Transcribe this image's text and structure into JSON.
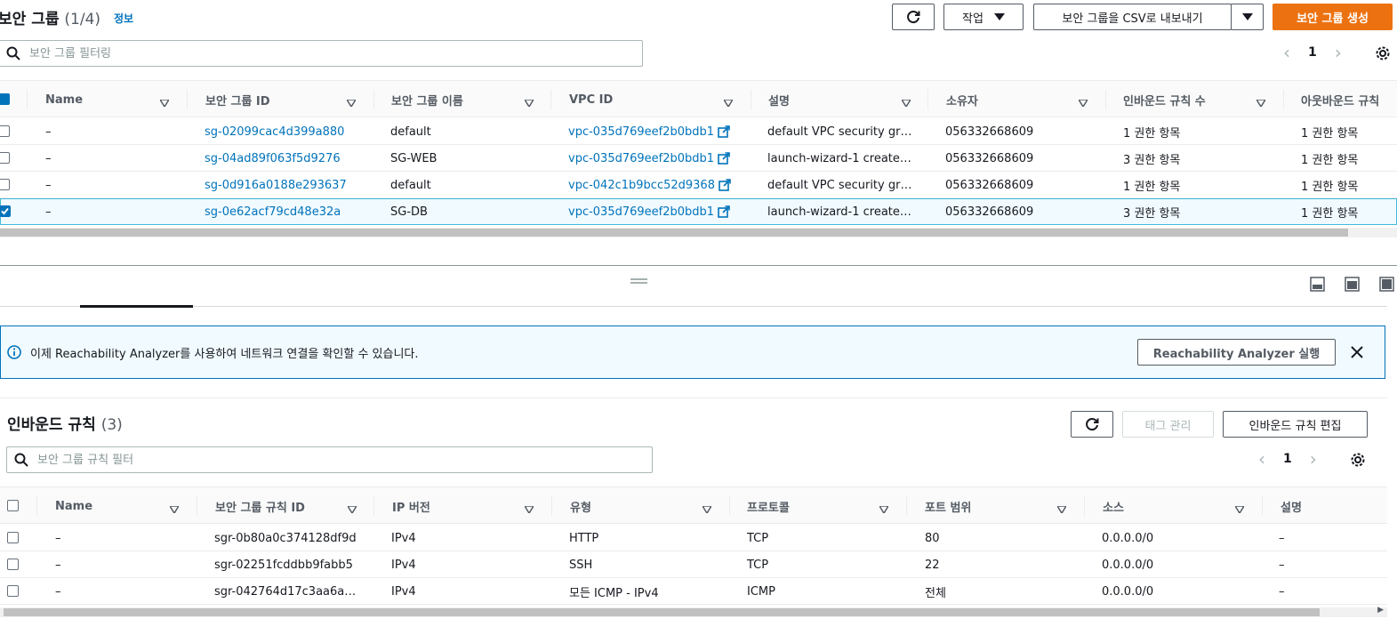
{
  "header": {
    "title": "보안 그룹",
    "count": "(1/4)",
    "info_link": "정보"
  },
  "toolbar": {
    "actions_label": "작업",
    "export_label": "보안 그룹을 CSV로 내보내기",
    "create_label": "보안 그룹 생성"
  },
  "search": {
    "placeholder": "보안 그룹 필터링"
  },
  "pager": {
    "page": "1"
  },
  "table": {
    "columns": [
      "Name",
      "보안 그룹 ID",
      "보안 그룹 이름",
      "VPC ID",
      "설명",
      "소유자",
      "인바운드 규칙 수",
      "아웃바운드 규칙"
    ],
    "rows": [
      {
        "selected": false,
        "name": "–",
        "id": "sg-02099cac4d399a880",
        "group_name": "default",
        "vpc": "vpc-035d769eef2b0bdb1",
        "desc": "default VPC security gr…",
        "owner": "056332668609",
        "inbound": "1 권한 항목",
        "outbound": "1 권한 항목"
      },
      {
        "selected": false,
        "name": "–",
        "id": "sg-04ad89f063f5d9276",
        "group_name": "SG-WEB",
        "vpc": "vpc-035d769eef2b0bdb1",
        "desc": "launch-wizard-1 create…",
        "owner": "056332668609",
        "inbound": "3 권한 항목",
        "outbound": "1 권한 항목"
      },
      {
        "selected": false,
        "name": "–",
        "id": "sg-0d916a0188e293637",
        "group_name": "default",
        "vpc": "vpc-042c1b9bcc52d9368",
        "desc": "default VPC security gr…",
        "owner": "056332668609",
        "inbound": "1 권한 항목",
        "outbound": "1 권한 항목"
      },
      {
        "selected": true,
        "name": "–",
        "id": "sg-0e62acf79cd48e32a",
        "group_name": "SG-DB",
        "vpc": "vpc-035d769eef2b0bdb1",
        "desc": "launch-wizard-1 create…",
        "owner": "056332668609",
        "inbound": "3 권한 항목",
        "outbound": "1 권한 항목"
      }
    ]
  },
  "flash": {
    "message": "이제 Reachability Analyzer를 사용하여 네트워크 연결을 확인할 수 있습니다.",
    "button_label": "Reachability Analyzer 실행"
  },
  "inbound": {
    "title": "인바운드 규칙",
    "count": "(3)",
    "manage_tags_label": "태그 관리",
    "edit_label": "인바운드 규칙 편집",
    "search_placeholder": "보안 그룹 규칙 필터",
    "page": "1",
    "columns": [
      "Name",
      "보안 그룹 규칙 ID",
      "IP 버전",
      "유형",
      "프로토콜",
      "포트 범위",
      "소스",
      "설명"
    ],
    "rows": [
      {
        "name": "–",
        "rule_id": "sgr-0b80a0c374128df9d",
        "ip": "IPv4",
        "type": "HTTP",
        "protocol": "TCP",
        "port": "80",
        "source": "0.0.0.0/0",
        "desc": "–"
      },
      {
        "name": "–",
        "rule_id": "sgr-02251fcddbb9fabb5",
        "ip": "IPv4",
        "type": "SSH",
        "protocol": "TCP",
        "port": "22",
        "source": "0.0.0.0/0",
        "desc": "–"
      },
      {
        "name": "–",
        "rule_id": "sgr-042764d17c3aa6a…",
        "ip": "IPv4",
        "type": "모든 ICMP - IPv4",
        "protocol": "ICMP",
        "port": "전체",
        "source": "0.0.0.0/0",
        "desc": "–"
      }
    ]
  },
  "colors": {
    "accent": "#ec7211",
    "link": "#0073bb",
    "selected_border": "#44b9d6"
  }
}
